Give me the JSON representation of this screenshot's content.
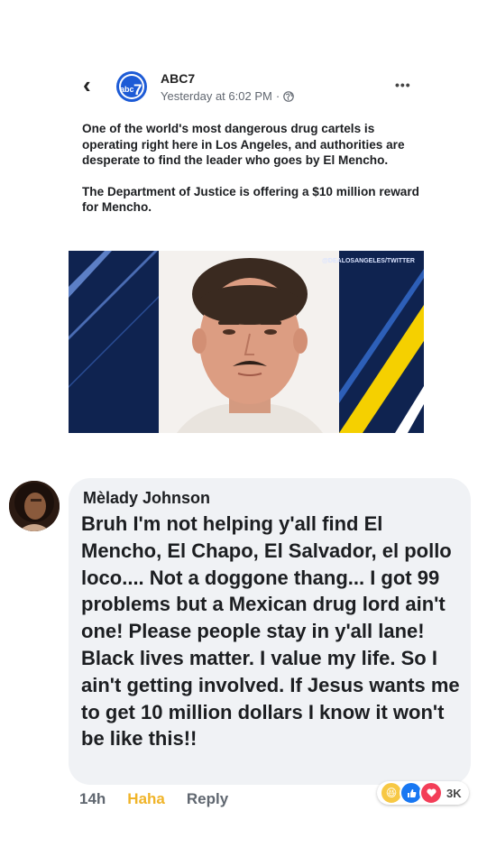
{
  "post": {
    "page_name": "ABC7",
    "timestamp": "Yesterday at 6:02 PM",
    "separator": "·",
    "logo_text": "abc",
    "logo_numeral": "7",
    "paragraphs": [
      "One of the world's most dangerous drug cartels is operating right here in Los Angeles, and authorities are desperate to find the leader who goes by El Mencho.",
      "The Department of Justice is offering a $10 million reward for Mencho."
    ],
    "image_watermark": "@DEALOSANGELES/TWITTER",
    "icons": {
      "back": "back-arrow-icon",
      "more": "more-options-icon",
      "privacy": "globe-icon"
    }
  },
  "comment": {
    "author": "Mèlady Johnson",
    "text": "Bruh I'm not helping y'all find El Mencho, El Chapo, El Salvador, el pollo loco.... Not a doggone thang... I got 99 problems but a Mexican drug lord ain't one! Please people stay in y'all lane! Black lives matter. I value my life. So I ain't getting involved. If Jesus wants me to get 10 million dollars I know it won't be like this!!",
    "time": "14h",
    "reaction_label": "Haha",
    "reply_label": "Reply",
    "reaction_count": "3K",
    "reactions": [
      "haha",
      "like",
      "love"
    ]
  },
  "colors": {
    "haha": "#f0b429",
    "like": "#1877f2",
    "love": "#f33e58",
    "bubble": "#f0f2f5",
    "image_navy": "#0f2350",
    "image_yellow": "#f5d000"
  }
}
